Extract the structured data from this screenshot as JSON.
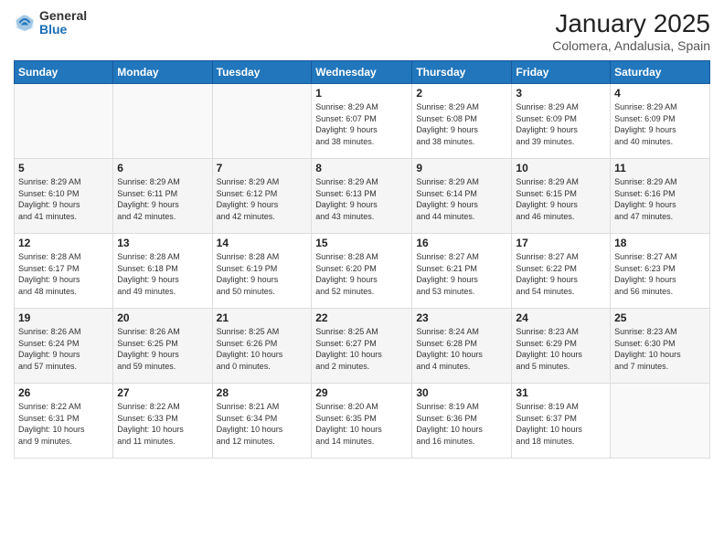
{
  "header": {
    "logo_general": "General",
    "logo_blue": "Blue",
    "month_year": "January 2025",
    "location": "Colomera, Andalusia, Spain"
  },
  "weekdays": [
    "Sunday",
    "Monday",
    "Tuesday",
    "Wednesday",
    "Thursday",
    "Friday",
    "Saturday"
  ],
  "weeks": [
    [
      {
        "day": "",
        "info": ""
      },
      {
        "day": "",
        "info": ""
      },
      {
        "day": "",
        "info": ""
      },
      {
        "day": "1",
        "info": "Sunrise: 8:29 AM\nSunset: 6:07 PM\nDaylight: 9 hours\nand 38 minutes."
      },
      {
        "day": "2",
        "info": "Sunrise: 8:29 AM\nSunset: 6:08 PM\nDaylight: 9 hours\nand 38 minutes."
      },
      {
        "day": "3",
        "info": "Sunrise: 8:29 AM\nSunset: 6:09 PM\nDaylight: 9 hours\nand 39 minutes."
      },
      {
        "day": "4",
        "info": "Sunrise: 8:29 AM\nSunset: 6:09 PM\nDaylight: 9 hours\nand 40 minutes."
      }
    ],
    [
      {
        "day": "5",
        "info": "Sunrise: 8:29 AM\nSunset: 6:10 PM\nDaylight: 9 hours\nand 41 minutes."
      },
      {
        "day": "6",
        "info": "Sunrise: 8:29 AM\nSunset: 6:11 PM\nDaylight: 9 hours\nand 42 minutes."
      },
      {
        "day": "7",
        "info": "Sunrise: 8:29 AM\nSunset: 6:12 PM\nDaylight: 9 hours\nand 42 minutes."
      },
      {
        "day": "8",
        "info": "Sunrise: 8:29 AM\nSunset: 6:13 PM\nDaylight: 9 hours\nand 43 minutes."
      },
      {
        "day": "9",
        "info": "Sunrise: 8:29 AM\nSunset: 6:14 PM\nDaylight: 9 hours\nand 44 minutes."
      },
      {
        "day": "10",
        "info": "Sunrise: 8:29 AM\nSunset: 6:15 PM\nDaylight: 9 hours\nand 46 minutes."
      },
      {
        "day": "11",
        "info": "Sunrise: 8:29 AM\nSunset: 6:16 PM\nDaylight: 9 hours\nand 47 minutes."
      }
    ],
    [
      {
        "day": "12",
        "info": "Sunrise: 8:28 AM\nSunset: 6:17 PM\nDaylight: 9 hours\nand 48 minutes."
      },
      {
        "day": "13",
        "info": "Sunrise: 8:28 AM\nSunset: 6:18 PM\nDaylight: 9 hours\nand 49 minutes."
      },
      {
        "day": "14",
        "info": "Sunrise: 8:28 AM\nSunset: 6:19 PM\nDaylight: 9 hours\nand 50 minutes."
      },
      {
        "day": "15",
        "info": "Sunrise: 8:28 AM\nSunset: 6:20 PM\nDaylight: 9 hours\nand 52 minutes."
      },
      {
        "day": "16",
        "info": "Sunrise: 8:27 AM\nSunset: 6:21 PM\nDaylight: 9 hours\nand 53 minutes."
      },
      {
        "day": "17",
        "info": "Sunrise: 8:27 AM\nSunset: 6:22 PM\nDaylight: 9 hours\nand 54 minutes."
      },
      {
        "day": "18",
        "info": "Sunrise: 8:27 AM\nSunset: 6:23 PM\nDaylight: 9 hours\nand 56 minutes."
      }
    ],
    [
      {
        "day": "19",
        "info": "Sunrise: 8:26 AM\nSunset: 6:24 PM\nDaylight: 9 hours\nand 57 minutes."
      },
      {
        "day": "20",
        "info": "Sunrise: 8:26 AM\nSunset: 6:25 PM\nDaylight: 9 hours\nand 59 minutes."
      },
      {
        "day": "21",
        "info": "Sunrise: 8:25 AM\nSunset: 6:26 PM\nDaylight: 10 hours\nand 0 minutes."
      },
      {
        "day": "22",
        "info": "Sunrise: 8:25 AM\nSunset: 6:27 PM\nDaylight: 10 hours\nand 2 minutes."
      },
      {
        "day": "23",
        "info": "Sunrise: 8:24 AM\nSunset: 6:28 PM\nDaylight: 10 hours\nand 4 minutes."
      },
      {
        "day": "24",
        "info": "Sunrise: 8:23 AM\nSunset: 6:29 PM\nDaylight: 10 hours\nand 5 minutes."
      },
      {
        "day": "25",
        "info": "Sunrise: 8:23 AM\nSunset: 6:30 PM\nDaylight: 10 hours\nand 7 minutes."
      }
    ],
    [
      {
        "day": "26",
        "info": "Sunrise: 8:22 AM\nSunset: 6:31 PM\nDaylight: 10 hours\nand 9 minutes."
      },
      {
        "day": "27",
        "info": "Sunrise: 8:22 AM\nSunset: 6:33 PM\nDaylight: 10 hours\nand 11 minutes."
      },
      {
        "day": "28",
        "info": "Sunrise: 8:21 AM\nSunset: 6:34 PM\nDaylight: 10 hours\nand 12 minutes."
      },
      {
        "day": "29",
        "info": "Sunrise: 8:20 AM\nSunset: 6:35 PM\nDaylight: 10 hours\nand 14 minutes."
      },
      {
        "day": "30",
        "info": "Sunrise: 8:19 AM\nSunset: 6:36 PM\nDaylight: 10 hours\nand 16 minutes."
      },
      {
        "day": "31",
        "info": "Sunrise: 8:19 AM\nSunset: 6:37 PM\nDaylight: 10 hours\nand 18 minutes."
      },
      {
        "day": "",
        "info": ""
      }
    ]
  ]
}
